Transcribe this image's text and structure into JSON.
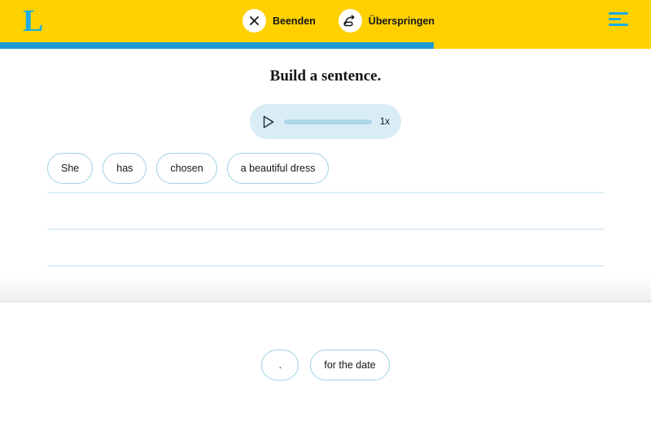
{
  "header": {
    "logo_text": "L",
    "logo_icon": "lingoda-l-logo",
    "actions": [
      {
        "icon": "close-x-icon",
        "label": "Beenden"
      },
      {
        "icon": "skip-forward-arrow-icon",
        "label": "Überspringen"
      }
    ],
    "menu_icon": "hamburger-menu-icon",
    "background_color": "#ffd100",
    "accent_color": "#1cabe3"
  },
  "progress": {
    "percent": 66.6,
    "fill_color": "#1c9ad6",
    "track_color": "#ffd100"
  },
  "exercise": {
    "title": "Build a sentence."
  },
  "audio": {
    "play_icon": "play-triangle-icon",
    "speed_label": "1x",
    "progress_percent": 0,
    "background_color": "#d9edf7",
    "track_color": "#aed5e5"
  },
  "answer_area": {
    "tiles": [
      {
        "label": "She"
      },
      {
        "label": "has"
      },
      {
        "label": "chosen"
      },
      {
        "label": "a beautiful dress"
      }
    ],
    "line_count": 3,
    "line_color": "#ddeff8"
  },
  "word_bank": {
    "tiles": [
      {
        "label": "."
      },
      {
        "label": "for the date"
      }
    ]
  },
  "tile_style": {
    "border_color": "#9ed0e6",
    "text_color": "#161616"
  }
}
